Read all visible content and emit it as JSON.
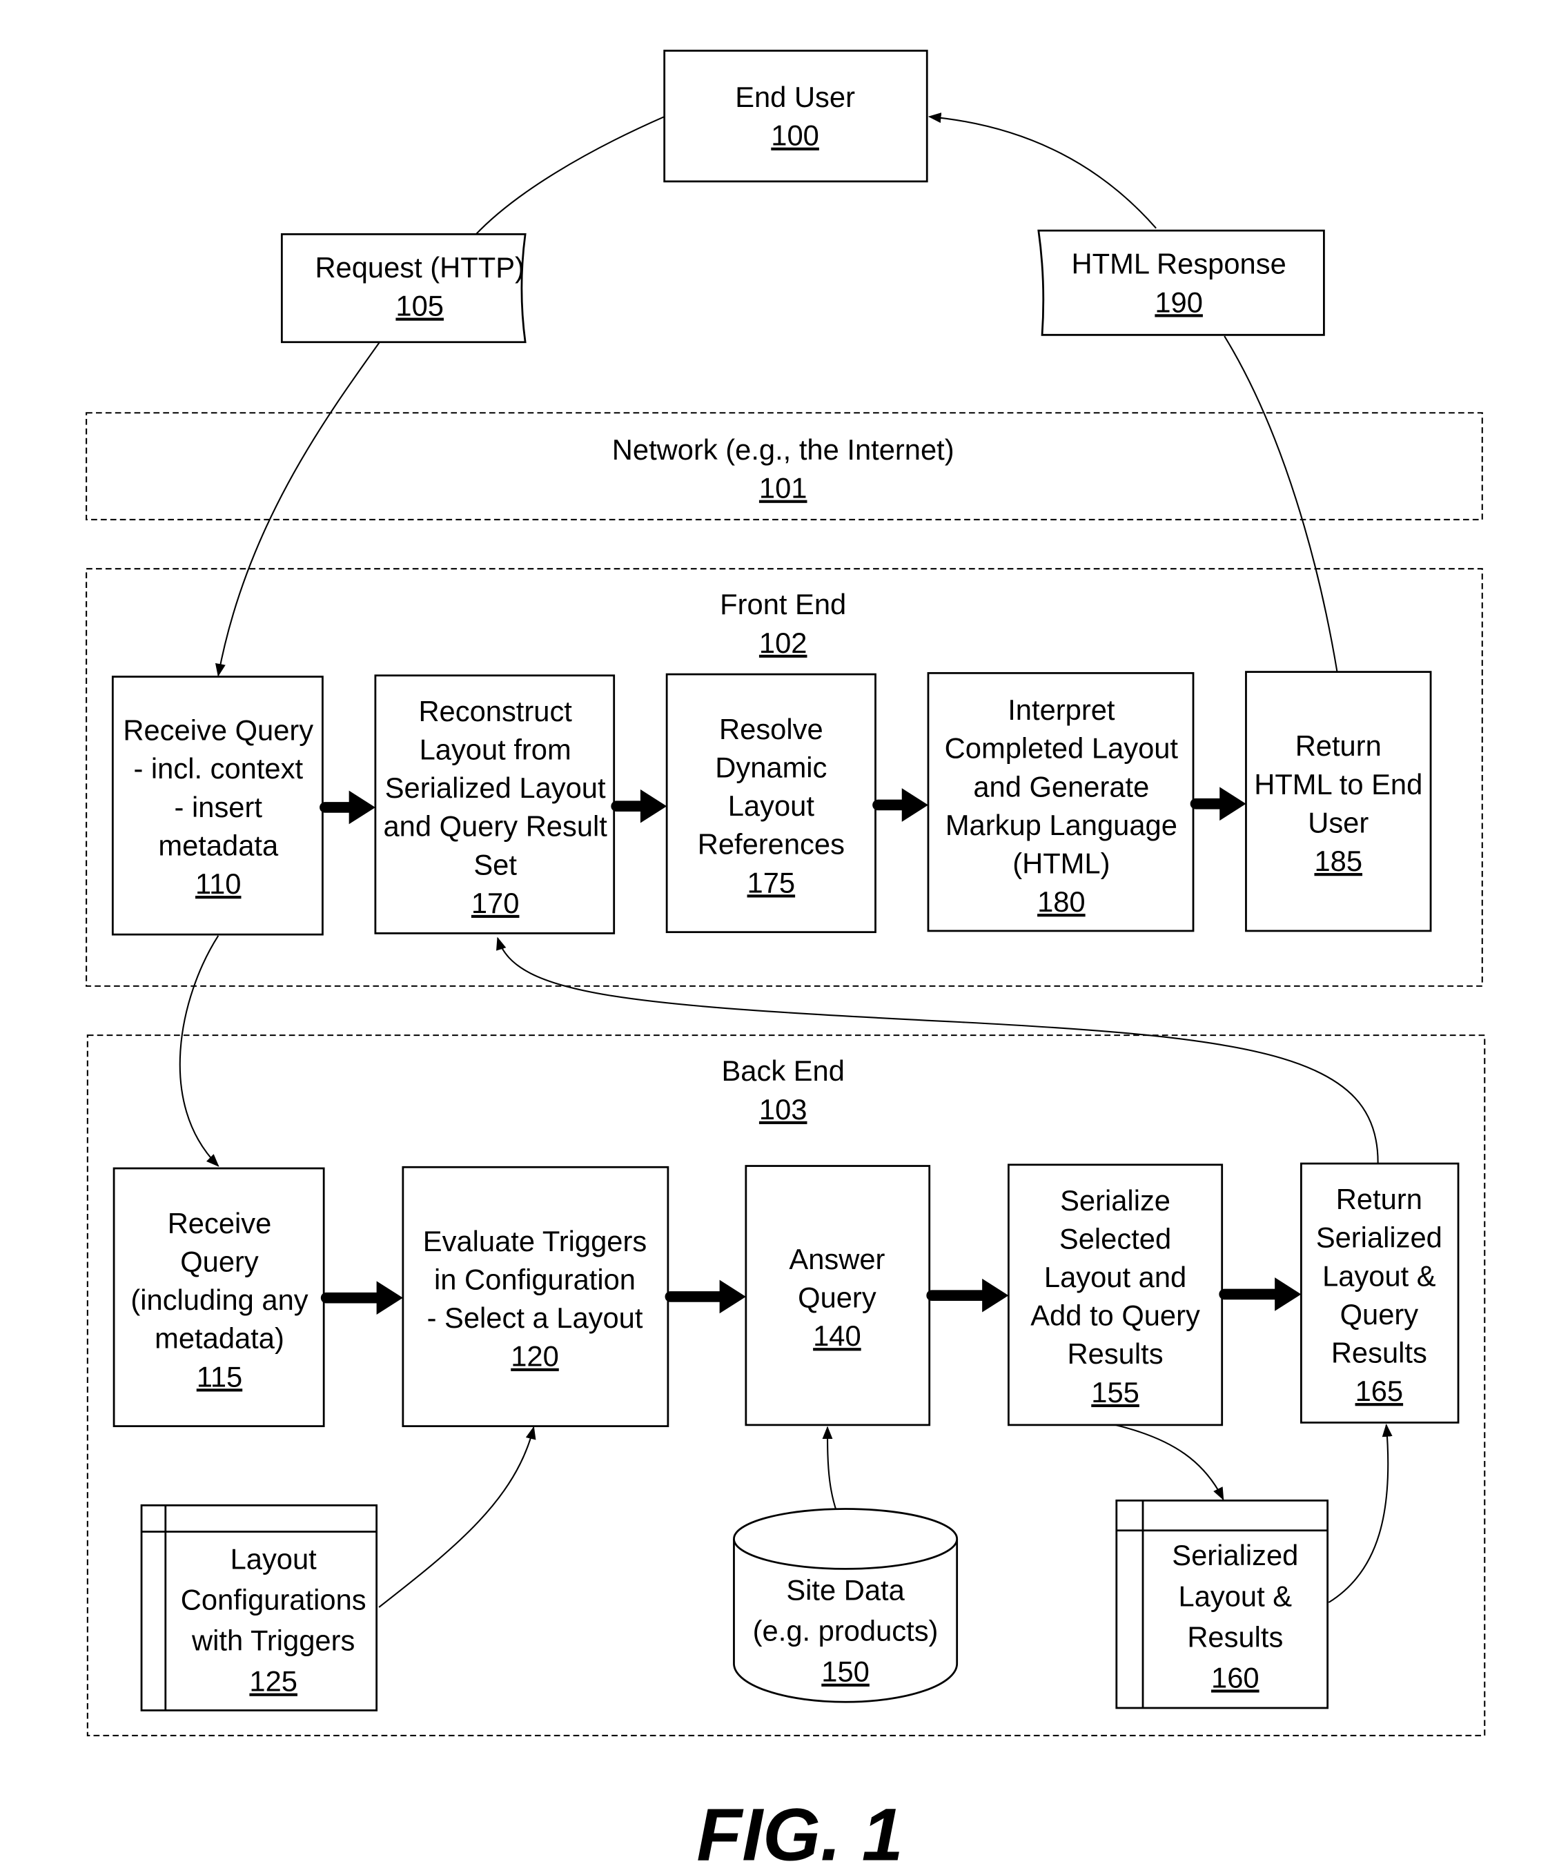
{
  "figure_label": "FIG. 1",
  "nodes": {
    "end_user": {
      "lines": [
        "End User"
      ],
      "ref": "100"
    },
    "request": {
      "lines": [
        "Request (HTTP)"
      ],
      "ref": "105"
    },
    "response": {
      "lines": [
        "HTML Response"
      ],
      "ref": "190"
    },
    "network": {
      "lines": [
        "Network  (e.g., the Internet)"
      ],
      "ref": "101"
    },
    "front_end": {
      "lines": [
        "Front End"
      ],
      "ref": "102"
    },
    "back_end": {
      "lines": [
        "Back End"
      ],
      "ref": "103"
    },
    "n110": {
      "lines": [
        "Receive Query",
        "- incl. context",
        "- insert",
        "metadata"
      ],
      "ref": "110"
    },
    "n170": {
      "lines": [
        "Reconstruct",
        "Layout from",
        "Serialized Layout",
        "and Query Result",
        "Set"
      ],
      "ref": "170"
    },
    "n175": {
      "lines": [
        "Resolve",
        "Dynamic",
        "Layout",
        "References"
      ],
      "ref": "175"
    },
    "n180": {
      "lines": [
        "Interpret",
        "Completed Layout",
        "and Generate",
        "Markup Language",
        "(HTML)"
      ],
      "ref": "180"
    },
    "n185": {
      "lines": [
        "Return",
        "HTML to End",
        "User"
      ],
      "ref": "185"
    },
    "n115": {
      "lines": [
        "Receive",
        "Query",
        "(including any",
        "metadata)"
      ],
      "ref": "115"
    },
    "n120": {
      "lines": [
        "Evaluate Triggers",
        "in Configuration",
        "- Select a Layout"
      ],
      "ref": "120"
    },
    "n140": {
      "lines": [
        "Answer",
        "Query"
      ],
      "ref": "140"
    },
    "n155": {
      "lines": [
        "Serialize",
        "Selected",
        "Layout and",
        "Add to Query",
        "Results"
      ],
      "ref": "155"
    },
    "n165": {
      "lines": [
        "Return",
        "Serialized",
        "Layout &",
        "Query",
        "Results"
      ],
      "ref": "165"
    },
    "n125": {
      "lines": [
        "Layout",
        "Configurations",
        "with Triggers"
      ],
      "ref": "125"
    },
    "n150": {
      "lines": [
        "Site Data",
        "(e.g. products)"
      ],
      "ref": "150"
    },
    "n160": {
      "lines": [
        "Serialized",
        "Layout &",
        "Results"
      ],
      "ref": "160"
    }
  }
}
